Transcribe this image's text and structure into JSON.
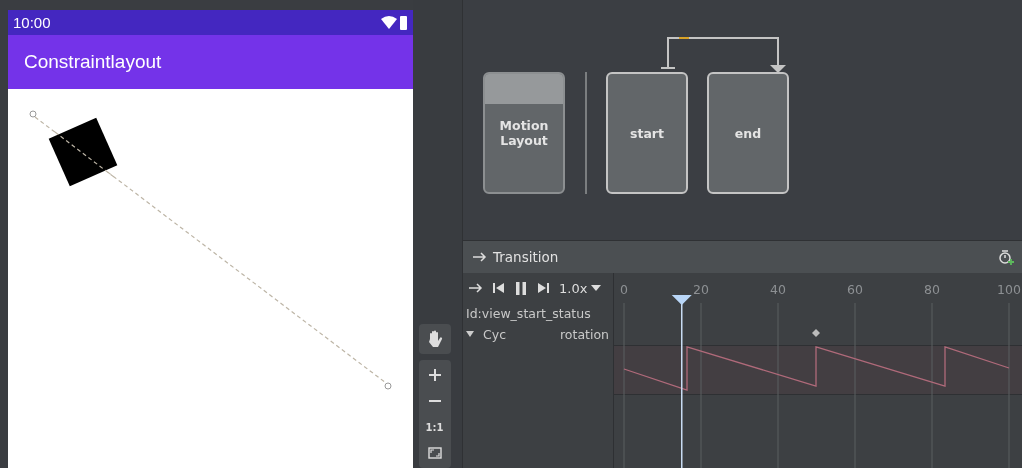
{
  "phone": {
    "status_time": "10:00",
    "app_title": "Constraintlayout"
  },
  "toolbar": {
    "zoom_actual": "1:1"
  },
  "states": [
    {
      "label": "Motion Layout",
      "kind": "layout"
    },
    {
      "label": "start",
      "kind": "state"
    },
    {
      "label": "end",
      "kind": "state"
    }
  ],
  "transition_panel": {
    "title": "Transition",
    "speed": "1.0x",
    "ruler_ticks": [
      "0",
      "20",
      "40",
      "60",
      "80",
      "100"
    ],
    "playhead": {
      "level": 0.15
    },
    "target": "Id:view_start_status",
    "tracks": [
      {
        "expanded": true,
        "type": "Cyc",
        "attribute": "rotation"
      }
    ]
  }
}
